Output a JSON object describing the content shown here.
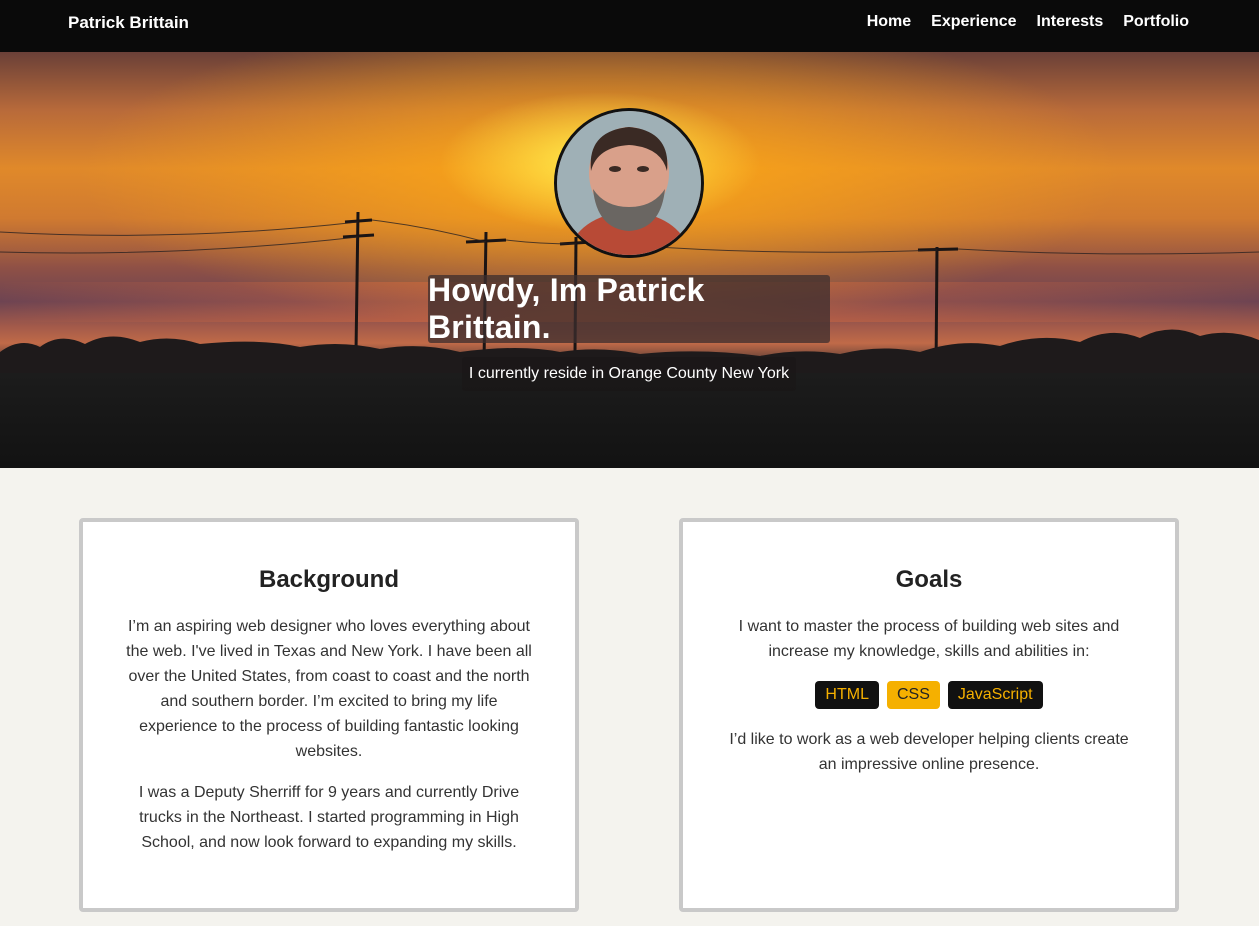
{
  "nav": {
    "brand": "Patrick Brittain",
    "links": [
      "Home",
      "Experience",
      "Interests",
      "Portfolio"
    ]
  },
  "hero": {
    "title": "Howdy, Im Patrick Brittain.",
    "subtitle": "I currently reside in Orange County New York"
  },
  "background_card": {
    "heading": "Background",
    "paragraph1": "I’m an aspiring web designer who loves everything about the web. I've lived in Texas and New York. I have been all over the United States, from coast to coast and the north and southern border. I’m excited to bring my life experience to the process of building fantastic looking websites.",
    "paragraph2": "I was a Deputy Sherriff for 9 years and currently Drive trucks in the Northeast. I started programming in High School, and now look forward to expanding my skills."
  },
  "goals_card": {
    "heading": "Goals",
    "paragraph1": "I want to master the process of building web sites and increase my knowledge, skills and abilities in:",
    "badges": [
      "HTML",
      "CSS",
      "JavaScript"
    ],
    "paragraph2": "I’d like to work as a web developer helping clients create an impressive online presence."
  },
  "colors": {
    "navbar": "#0a0a0a",
    "accent": "#f5b000",
    "page_background": "#f4f3ee",
    "card_border": "#c9c9c9"
  }
}
